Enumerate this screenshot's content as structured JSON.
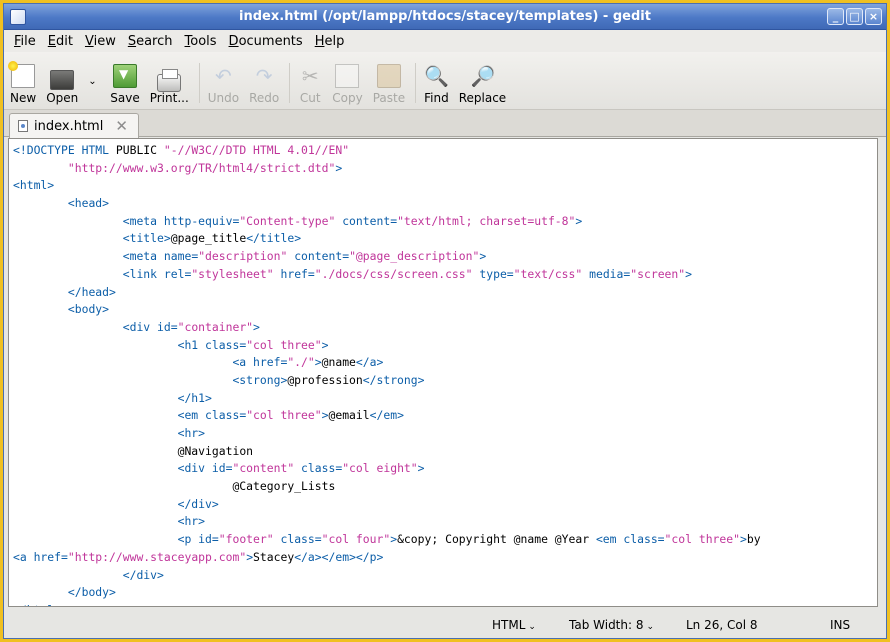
{
  "window": {
    "title": "index.html (/opt/lampp/htdocs/stacey/templates) - gedit",
    "buttons": [
      "_",
      "□",
      "×"
    ]
  },
  "menu": [
    {
      "mnemonic": "F",
      "rest": "ile"
    },
    {
      "mnemonic": "E",
      "rest": "dit"
    },
    {
      "mnemonic": "V",
      "rest": "iew"
    },
    {
      "mnemonic": "S",
      "rest": "earch"
    },
    {
      "mnemonic": "T",
      "rest": "ools"
    },
    {
      "mnemonic": "D",
      "rest": "ocuments"
    },
    {
      "mnemonic": "H",
      "rest": "elp"
    }
  ],
  "toolbar": {
    "new": "New",
    "open": "Open",
    "save": "Save",
    "print": "Print...",
    "undo": "Undo",
    "redo": "Redo",
    "cut": "Cut",
    "copy": "Copy",
    "paste": "Paste",
    "find": "Find",
    "replace": "Replace",
    "icons": {
      "new": "new-document-icon",
      "open": "open-folder-icon",
      "save": "save-icon",
      "print": "printer-icon",
      "undo": "undo-arrow-icon",
      "redo": "redo-arrow-icon",
      "cut": "scissors-icon",
      "copy": "copy-icon",
      "paste": "clipboard-icon",
      "find": "binoculars-icon",
      "replace": "binoculars-replace-icon"
    }
  },
  "tab": {
    "label": "index.html",
    "close": "✕"
  },
  "code_lines": [
    [
      [
        "t",
        "<!DOCTYPE HTML "
      ],
      [
        "x",
        "PUBLIC "
      ],
      [
        "s",
        "\"-//W3C//DTD HTML 4.01//EN\""
      ]
    ],
    [
      [
        "x",
        "        "
      ],
      [
        "s",
        "\"http://www.w3.org/TR/html4/strict.dtd\""
      ],
      [
        "t",
        ">"
      ]
    ],
    [
      [
        "t",
        "<html>"
      ]
    ],
    [
      [
        "x",
        "        "
      ],
      [
        "t",
        "<head>"
      ]
    ],
    [
      [
        "x",
        "                "
      ],
      [
        "t",
        "<meta "
      ],
      [
        "a",
        "http-equiv="
      ],
      [
        "s",
        "\"Content-type\" "
      ],
      [
        "a",
        "content="
      ],
      [
        "s",
        "\"text/html; charset=utf-8\""
      ],
      [
        "t",
        ">"
      ]
    ],
    [
      [
        "x",
        "                "
      ],
      [
        "t",
        "<title>"
      ],
      [
        "x",
        "@page_title"
      ],
      [
        "t",
        "</title>"
      ]
    ],
    [
      [
        "x",
        "                "
      ],
      [
        "t",
        "<meta "
      ],
      [
        "a",
        "name="
      ],
      [
        "s",
        "\"description\" "
      ],
      [
        "a",
        "content="
      ],
      [
        "s",
        "\"@page_description\""
      ],
      [
        "t",
        ">"
      ]
    ],
    [
      [
        "x",
        "                "
      ],
      [
        "t",
        "<link "
      ],
      [
        "a",
        "rel="
      ],
      [
        "s",
        "\"stylesheet\" "
      ],
      [
        "a",
        "href="
      ],
      [
        "s",
        "\"./docs/css/screen.css\" "
      ],
      [
        "a",
        "type="
      ],
      [
        "s",
        "\"text/css\" "
      ],
      [
        "a",
        "media="
      ],
      [
        "s",
        "\"screen\""
      ],
      [
        "t",
        ">"
      ]
    ],
    [
      [
        "x",
        "        "
      ],
      [
        "t",
        "</head>"
      ]
    ],
    [
      [
        "x",
        "        "
      ],
      [
        "t",
        "<body>"
      ]
    ],
    [
      [
        "x",
        "                "
      ],
      [
        "t",
        "<div "
      ],
      [
        "a",
        "id="
      ],
      [
        "s",
        "\"container\""
      ],
      [
        "t",
        ">"
      ]
    ],
    [
      [
        "x",
        "                        "
      ],
      [
        "t",
        "<h1 "
      ],
      [
        "a",
        "class="
      ],
      [
        "s",
        "\"col three\""
      ],
      [
        "t",
        ">"
      ]
    ],
    [
      [
        "x",
        "                                "
      ],
      [
        "t",
        "<a "
      ],
      [
        "a",
        "href="
      ],
      [
        "s",
        "\"./\""
      ],
      [
        "t",
        ">"
      ],
      [
        "x",
        "@name"
      ],
      [
        "t",
        "</a>"
      ]
    ],
    [
      [
        "x",
        "                                "
      ],
      [
        "t",
        "<strong>"
      ],
      [
        "x",
        "@profession"
      ],
      [
        "t",
        "</strong>"
      ]
    ],
    [
      [
        "x",
        "                        "
      ],
      [
        "t",
        "</h1>"
      ]
    ],
    [
      [
        "x",
        "                        "
      ],
      [
        "t",
        "<em "
      ],
      [
        "a",
        "class="
      ],
      [
        "s",
        "\"col three\""
      ],
      [
        "t",
        ">"
      ],
      [
        "x",
        "@email"
      ],
      [
        "t",
        "</em>"
      ]
    ],
    [
      [
        "x",
        "                        "
      ],
      [
        "t",
        "<hr>"
      ]
    ],
    [
      [
        "x",
        "                        "
      ],
      [
        "x",
        "@Navigation"
      ]
    ],
    [
      [
        "x",
        "                        "
      ],
      [
        "t",
        "<div "
      ],
      [
        "a",
        "id="
      ],
      [
        "s",
        "\"content\" "
      ],
      [
        "a",
        "class="
      ],
      [
        "s",
        "\"col eight\""
      ],
      [
        "t",
        ">"
      ]
    ],
    [
      [
        "x",
        "                                "
      ],
      [
        "x",
        "@Category_Lists"
      ]
    ],
    [
      [
        "x",
        "                        "
      ],
      [
        "t",
        "</div>"
      ]
    ],
    [
      [
        "x",
        "                        "
      ],
      [
        "t",
        "<hr>"
      ]
    ],
    [
      [
        "x",
        "                        "
      ],
      [
        "t",
        "<p "
      ],
      [
        "a",
        "id="
      ],
      [
        "s",
        "\"footer\" "
      ],
      [
        "a",
        "class="
      ],
      [
        "s",
        "\"col four\""
      ],
      [
        "t",
        ">"
      ],
      [
        "x",
        "&copy; Copyright @name @Year "
      ],
      [
        "t",
        "<em "
      ],
      [
        "a",
        "class="
      ],
      [
        "s",
        "\"col three\""
      ],
      [
        "t",
        ">"
      ],
      [
        "x",
        "by"
      ]
    ],
    [
      [
        "t",
        "<a "
      ],
      [
        "a",
        "href="
      ],
      [
        "s",
        "\"http://www.staceyapp.com\""
      ],
      [
        "t",
        ">"
      ],
      [
        "x",
        "Stacey"
      ],
      [
        "t",
        "</a></em></p>"
      ]
    ],
    [
      [
        "x",
        "                "
      ],
      [
        "t",
        "</div>"
      ]
    ],
    [
      [
        "x",
        "        "
      ],
      [
        "t",
        "</body>"
      ]
    ],
    [
      [
        "t",
        "</html>"
      ]
    ]
  ],
  "status": {
    "language": "HTML",
    "tab_width": "Tab Width: 8",
    "position": "Ln 26, Col 8",
    "mode": "INS"
  }
}
